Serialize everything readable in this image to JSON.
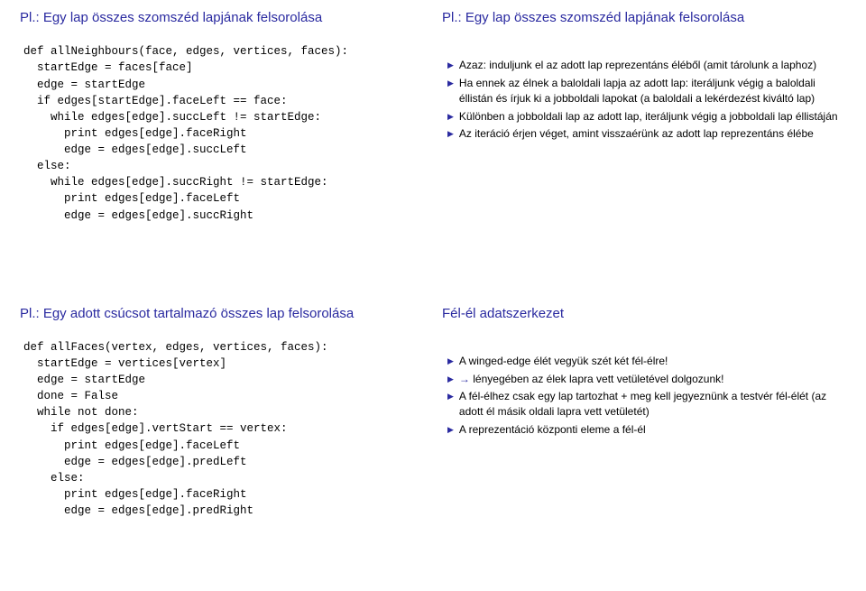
{
  "q1": {
    "title": "Pl.: Egy lap összes szomszéd lapjának felsorolása",
    "code": "def allNeighbours(face, edges, vertices, faces):\n  startEdge = faces[face]\n  edge = startEdge\n  if edges[startEdge].faceLeft == face:\n    while edges[edge].succLeft != startEdge:\n      print edges[edge].faceRight\n      edge = edges[edge].succLeft\n  else:\n    while edges[edge].succRight != startEdge:\n      print edges[edge].faceLeft\n      edge = edges[edge].succRight"
  },
  "q2": {
    "title": "Pl.: Egy lap összes szomszéd lapjának felsorolása",
    "bullets": [
      "Azaz: induljunk el az adott lap reprezentáns éléből (amit tárolunk a laphoz)",
      "Ha ennek az élnek a baloldali lapja az adott lap: iteráljunk végig a baloldali éllistán és írjuk ki a jobboldali lapokat (a baloldali a lekérdezést kiváltó lap)",
      "Különben a jobboldali lap az adott lap, iteráljunk végig a jobboldali lap éllistáján",
      "Az iteráció érjen véget, amint visszaérünk az adott lap reprezentáns élébe"
    ]
  },
  "q3": {
    "title": "Pl.: Egy adott csúcsot tartalmazó összes lap felsorolása",
    "code": "def allFaces(vertex, edges, vertices, faces):\n  startEdge = vertices[vertex]\n  edge = startEdge\n  done = False\n  while not done:\n    if edges[edge].vertStart == vertex:\n      print edges[edge].faceLeft\n      edge = edges[edge].predLeft\n    else:\n      print edges[edge].faceRight\n      edge = edges[edge].predRight"
  },
  "q4": {
    "title": "Fél-él adatszerkezet",
    "bullets": [
      {
        "text": "A winged-edge élét vegyük szét két fél-élre!"
      },
      {
        "prefix": "→ ",
        "text": "lényegében az élek lapra vett vetületével dolgozunk!"
      },
      {
        "text": "A fél-élhez csak egy lap tartozhat + meg kell jegyeznünk a testvér fél-élét (az adott él másik oldali lapra vett vetületét)"
      },
      {
        "text": "A reprezentáció központi eleme a fél-él"
      }
    ]
  }
}
